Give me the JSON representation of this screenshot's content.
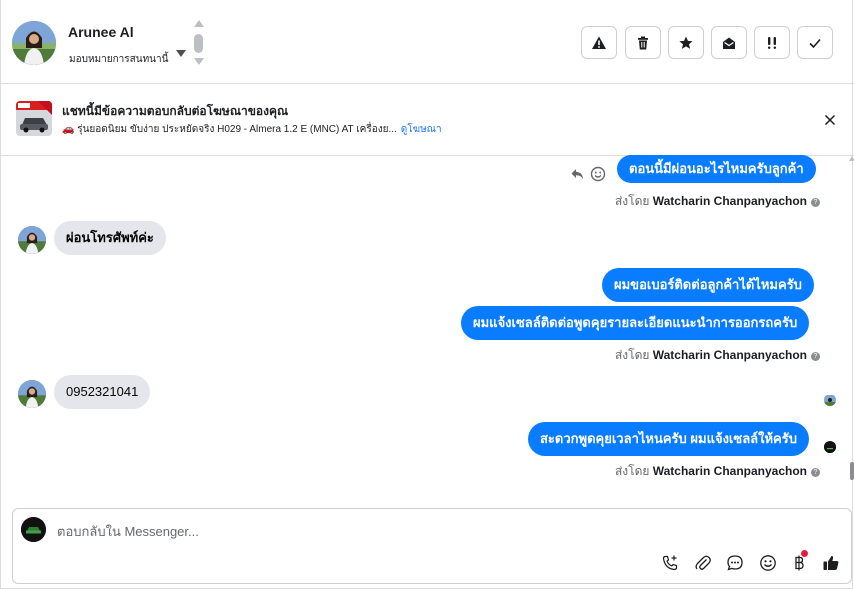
{
  "header": {
    "contact_name": "Arunee Al",
    "assign_label": "มอบหมายการสนทนานี้",
    "tools": [
      {
        "name": "report-spam-button",
        "icon": "warning-icon"
      },
      {
        "name": "delete-button",
        "icon": "trash-icon"
      },
      {
        "name": "star-button",
        "icon": "star-icon"
      },
      {
        "name": "mark-unread-button",
        "icon": "envelope-open-icon"
      },
      {
        "name": "follow-up-button",
        "icon": "exclamation-icon"
      },
      {
        "name": "mark-done-button",
        "icon": "check-icon"
      }
    ]
  },
  "ad": {
    "title": "แชทนี้มีข้อความตอบกลับต่อโฆษณาของคุณ",
    "subtitle": "🚗 รุ่นยอดนิยม ขับง่าย ประหยัดจริง H029 - Almera 1.2 E (MNC) AT เครื่องย...",
    "link": "ดูโฆษณา"
  },
  "messages": [
    {
      "text": "ตอนนี้มีผ่อนอะไรไหมครับลูกค้า"
    },
    {
      "text": "ผ่อนโทรศัพท์ค่ะ"
    },
    {
      "text": "ผมขอเบอร์ติดต่อลูกค้าได้ไหมครับ"
    },
    {
      "text": "ผมแจ้งเซลล์ติดต่อพูดคุยรายละเอียดแนะนำการออกรถครับ"
    },
    {
      "text": "0952321041"
    },
    {
      "text": "สะดวกพูดคุยเวลาไหนครับ ผมแจ้งเซลล์ให้ครับ"
    }
  ],
  "sent_by": {
    "prefix": "ส่งโดย",
    "name": "Watcharin Chanpanyachon",
    "info": "?"
  },
  "composer": {
    "placeholder": "ตอบกลับใน Messenger..."
  },
  "colors": {
    "outgoing_bubble": "#0a7cff",
    "incoming_bubble": "#e4e6eb",
    "link": "#1877f2",
    "notification_dot": "#e41e3f"
  }
}
